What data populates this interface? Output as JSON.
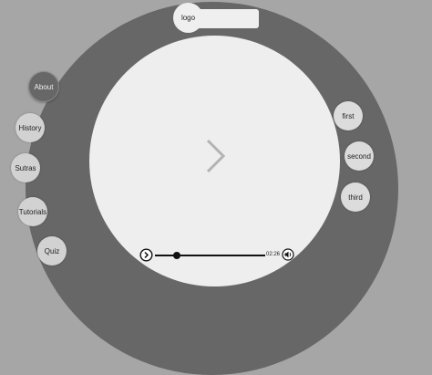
{
  "logo": {
    "label": "logo"
  },
  "nav": {
    "items": [
      {
        "label": "About",
        "active": true
      },
      {
        "label": "History"
      },
      {
        "label": "Sutras"
      },
      {
        "label": "Tutorials"
      },
      {
        "label": "Quiz"
      }
    ]
  },
  "sections": {
    "items": [
      {
        "label": "first"
      },
      {
        "label": "second"
      },
      {
        "label": "third"
      }
    ]
  },
  "player": {
    "time": "02:26",
    "progress": 0.2
  },
  "colors": {
    "background": "#a6a6a6",
    "ring": "#676767",
    "stage": "#eeeeee",
    "active_nav": "#676767"
  }
}
